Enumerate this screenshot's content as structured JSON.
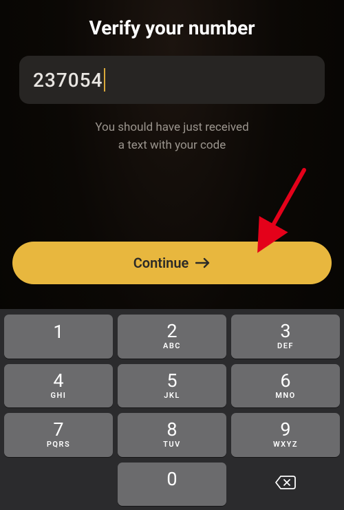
{
  "title": "Verify your number",
  "code_input": {
    "value": "237054"
  },
  "helper_line1": "You should have just received",
  "helper_line2": "a text with your code",
  "continue": {
    "label": "Continue"
  },
  "keypad": {
    "rows": [
      [
        {
          "digit": "1",
          "letters": ""
        },
        {
          "digit": "2",
          "letters": "ABC"
        },
        {
          "digit": "3",
          "letters": "DEF"
        }
      ],
      [
        {
          "digit": "4",
          "letters": "GHI"
        },
        {
          "digit": "5",
          "letters": "JKL"
        },
        {
          "digit": "6",
          "letters": "MNO"
        }
      ],
      [
        {
          "digit": "7",
          "letters": "PQRS"
        },
        {
          "digit": "8",
          "letters": "TUV"
        },
        {
          "digit": "9",
          "letters": "WXYZ"
        }
      ],
      [
        {
          "blank": true
        },
        {
          "digit": "0",
          "letters": ""
        },
        {
          "backspace": true
        }
      ]
    ]
  },
  "colors": {
    "accent": "#e8b73e",
    "key_bg": "#6b6b6d",
    "keyboard_bg": "#2b2b2d"
  }
}
